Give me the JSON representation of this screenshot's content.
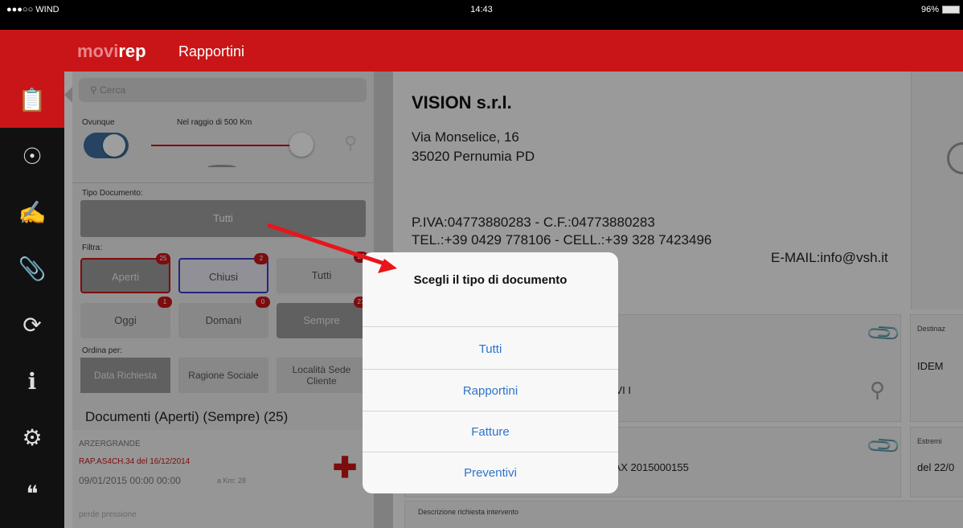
{
  "status": {
    "carrier": "●●●○○ WIND",
    "time": "14:43",
    "battery": "96%"
  },
  "brand": {
    "mov": "movi",
    "rep": "rep",
    "section": "Rapportini"
  },
  "sidebar": [
    {
      "icon": "clipboard-icon"
    },
    {
      "icon": "person-icon"
    },
    {
      "icon": "handshake-icon"
    },
    {
      "icon": "paperclip-icon"
    },
    {
      "icon": "sync-icon"
    },
    {
      "icon": "info-icon"
    },
    {
      "icon": "gear-icon"
    },
    {
      "icon": "exit-icon"
    }
  ],
  "list": {
    "search_placeholder": "Cerca",
    "ovunque": "Ovunque",
    "raggio": "Nel raggio di 500 Km",
    "tipo_documento_label": "Tipo Documento:",
    "tipo_documento_value": "Tutti",
    "filtra_label": "Filtra:",
    "filters": [
      {
        "label": "Aperti",
        "count": "25"
      },
      {
        "label": "Chiusi",
        "count": "2"
      },
      {
        "label": "Tutti",
        "count": "27"
      },
      {
        "label": "Oggi",
        "count": "1"
      },
      {
        "label": "Domani",
        "count": "0"
      },
      {
        "label": "Sempre",
        "count": "27"
      }
    ],
    "ordina_label": "Ordina per:",
    "sort": [
      "Data Richiesta",
      "Ragione Sociale",
      "Località Sede Cliente"
    ],
    "documents_title": "Documenti (Aperti) (Sempre) (25)",
    "item": {
      "location": "ARZERGRANDE",
      "code": "RAP.AS4CH.34 del 16/12/2014",
      "date": "09/01/2015  00:00  00:00",
      "km": "a Km: 28",
      "desc": "perde pressione"
    }
  },
  "detail": {
    "company": "VISION s.r.l.",
    "address1": "Via Monselice, 16",
    "address2": "35020 Pernumia PD",
    "piva": "P.IVA:04773880283 - C.F.:04773880283",
    "tel": "TEL.:+39 0429 778106 - CELL.:+39 328 7423496",
    "email": "E-MAIL:info@vsh.it",
    "card1_text": "OTTO VI I",
    "card1_side_label": "Destinaz",
    "card1_side_value": "IDEM",
    "card2_text": "OD. MAX 2015000155",
    "card2_side_label": "Estremi",
    "card2_side_value": "del 22/0",
    "descr_label": "Descrizione richiesta intervento"
  },
  "alert": {
    "title": "Scegli il tipo di documento",
    "options": [
      "Tutti",
      "Rapportini",
      "Fatture",
      "Preventivi"
    ]
  },
  "colors": {
    "brand_red": "#c91517",
    "ios_blue": "#2f73c8",
    "annotation_arrow": "#e8151b"
  }
}
